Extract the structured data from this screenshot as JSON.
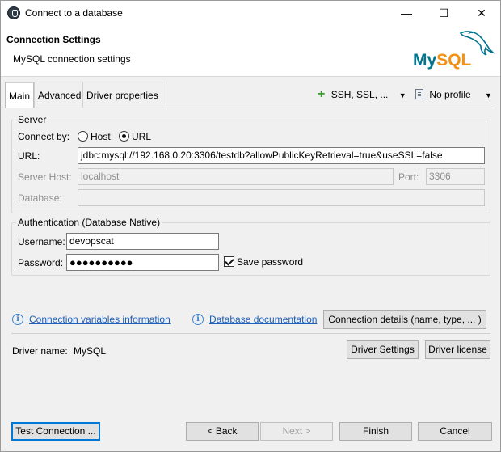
{
  "window": {
    "title": "Connect to a database",
    "minimize": "—",
    "maximize": "☐",
    "close": "✕"
  },
  "header": {
    "title": "Connection Settings",
    "subtitle": "MySQL connection settings",
    "logo_my": "My",
    "logo_sql": "SQL"
  },
  "tabs": [
    {
      "label": "Main"
    },
    {
      "label": "Advanced"
    },
    {
      "label": "Driver properties"
    }
  ],
  "toolbar": {
    "ssh_label": "SSH, SSL, ...",
    "profile_label": "No profile"
  },
  "server": {
    "group_label": "Server",
    "connect_by_label": "Connect by:",
    "host_option": "Host",
    "url_option": "URL",
    "selected": "URL",
    "url_label": "URL:",
    "url_value": "jdbc:mysql://192.168.0.20:3306/testdb?allowPublicKeyRetrieval=true&useSSL=false",
    "host_label": "Server Host:",
    "host_value": "localhost",
    "port_label": "Port:",
    "port_value": "3306",
    "database_label": "Database:",
    "database_value": ""
  },
  "auth": {
    "group_label": "Authentication (Database Native)",
    "username_label": "Username:",
    "username_value": "devopscat",
    "password_label": "Password:",
    "password_value": "●●●●●●●●●●",
    "save_password_label": "Save password",
    "save_password_checked": true
  },
  "links": {
    "conn_vars": "Connection variables information",
    "db_docs": "Database documentation",
    "details_button": "Connection details (name, type, ... )"
  },
  "driver": {
    "name_label": "Driver name:",
    "name_value": "MySQL",
    "settings_button": "Driver Settings",
    "license_button": "Driver license"
  },
  "footer": {
    "test_button": "Test Connection ...",
    "back_button": "< Back",
    "next_button": "Next >",
    "finish_button": "Finish",
    "cancel_button": "Cancel"
  },
  "colors": {
    "link": "#1f5fb8",
    "focus": "#0078d7",
    "mysql_blue": "#00758f",
    "mysql_orange": "#f29111"
  }
}
